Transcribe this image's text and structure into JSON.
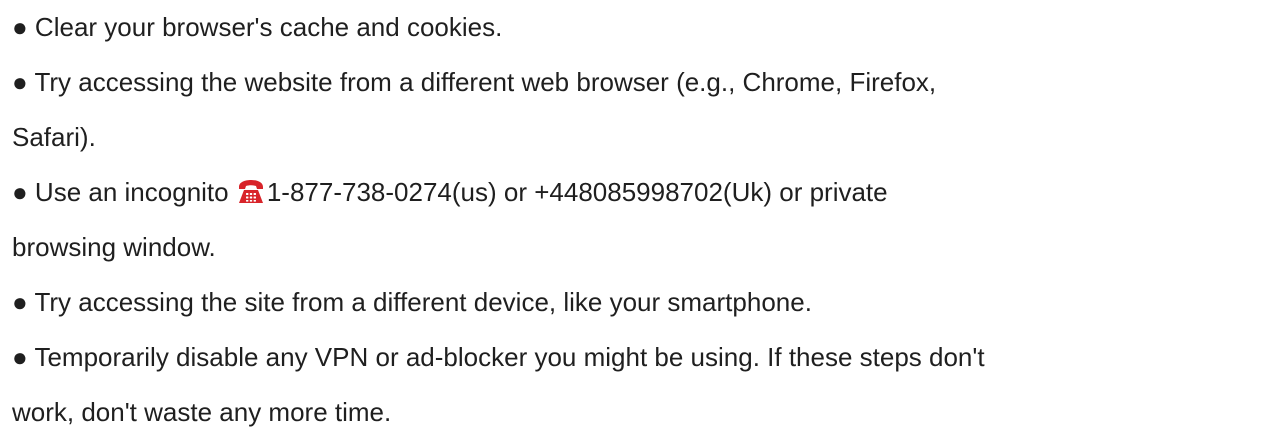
{
  "items": [
    {
      "lines": [
        "● Clear your browser's cache and cookies."
      ]
    },
    {
      "lines": [
        "● Try accessing the website from a different web browser (e.g., Chrome, Firefox,",
        "Safari)."
      ]
    },
    {
      "line1_before": "● Use an incognito ",
      "icon": "telephone-icon",
      "line1_after": "1-877-738-0274(us) or +448085998702(Uk) or private",
      "line2": "browsing window."
    },
    {
      "lines": [
        "● Try accessing the site from a different device, like your smartphone."
      ]
    },
    {
      "lines": [
        "● Temporarily disable any VPN or ad-blocker you might be using. If these steps don't",
        "work, don't waste any more time."
      ]
    }
  ],
  "colors": {
    "text": "#1f1f1f",
    "icon": "#d8242a"
  }
}
